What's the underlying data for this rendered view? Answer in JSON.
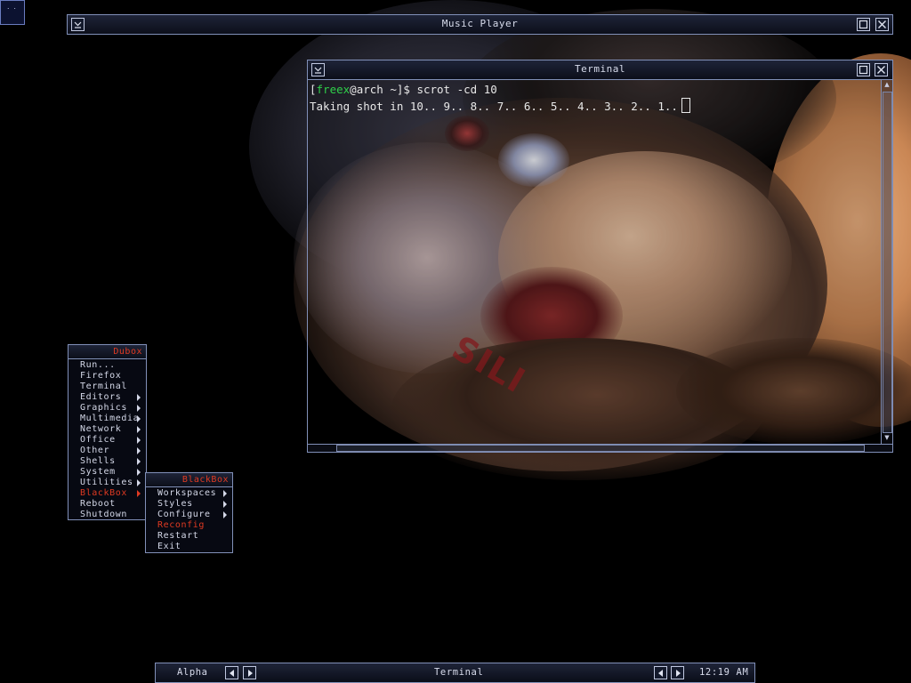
{
  "windows": {
    "music_player": {
      "title": "Music Player"
    },
    "terminal": {
      "title": "Terminal",
      "prompt": {
        "open_bracket": "[",
        "user": "freex",
        "host_part": "@arch ~]$ ",
        "command": "scrot -cd 10"
      },
      "output": "Taking shot in 10.. 9.. 8.. 7.. 6.. 5.. 4.. 3.. 2.. 1.."
    }
  },
  "wallpaper": {
    "tattoo_text": "SILI"
  },
  "root_menu": {
    "title": "Dubox",
    "items": [
      {
        "label": "Run..."
      },
      {
        "label": "Firefox"
      },
      {
        "label": "Terminal"
      },
      {
        "label": "Editors"
      },
      {
        "label": "Graphics"
      },
      {
        "label": "Multimedia"
      },
      {
        "label": "Network"
      },
      {
        "label": "Office"
      },
      {
        "label": "Other"
      },
      {
        "label": "Shells"
      },
      {
        "label": "System"
      },
      {
        "label": "Utilities"
      },
      {
        "label": "BlackBox"
      },
      {
        "label": "Reboot"
      },
      {
        "label": "Shutdown"
      }
    ]
  },
  "blackbox_menu": {
    "title": "BlackBox",
    "items": [
      {
        "label": "Workspaces"
      },
      {
        "label": "Styles"
      },
      {
        "label": "Configure"
      },
      {
        "label": "Reconfig"
      },
      {
        "label": "Restart"
      },
      {
        "label": "Exit"
      }
    ]
  },
  "taskbar": {
    "workspace": "Alpha",
    "window_name": "Terminal",
    "clock": "12:19 AM"
  },
  "colors": {
    "accent_red": "#e03a22",
    "prompt_green": "#2fd04a",
    "frame_border": "#8190b8",
    "menu_text": "#d4d8e8"
  },
  "icons": {
    "shade": "chevron-down-icon",
    "maximize": "maximize-icon",
    "close": "close-icon",
    "submenu": "triangle-right-icon",
    "prev": "triangle-left-icon",
    "next": "triangle-right-icon"
  }
}
